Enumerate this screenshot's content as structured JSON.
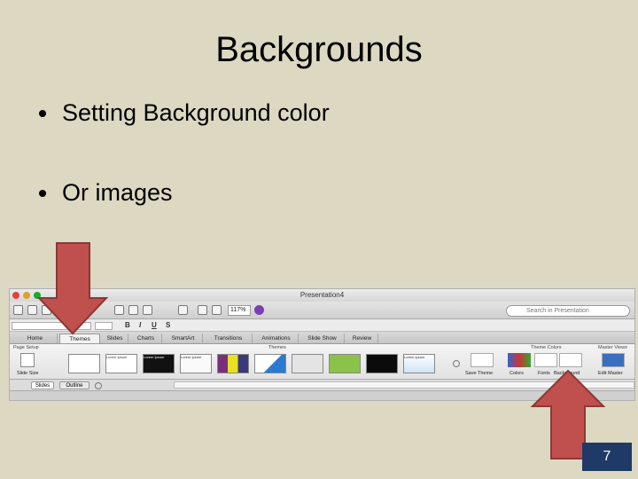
{
  "slide": {
    "title": "Backgrounds",
    "bullets": [
      "Setting Background color",
      "Or images"
    ],
    "page_number": "7"
  },
  "app": {
    "window_title": "Presentation4",
    "zoom": "117%",
    "search_placeholder": "Search in Presentation",
    "format_labels": [
      "B",
      "I",
      "U",
      "S"
    ],
    "tabs": [
      "Home",
      "Themes",
      "Slides",
      "Charts",
      "SmartArt",
      "Transitions",
      "Animations",
      "Slide Show",
      "Review"
    ],
    "active_tab": "Themes",
    "ribbon": {
      "page_setup_label": "Page Setup",
      "slide_size_label": "Slide Size",
      "themes_label": "Themes",
      "theme_colors_label": "Theme Colors",
      "master_views_label": "Master Views",
      "theme_thumb_text": "Lorem Ipsum",
      "save_theme": "Save Theme",
      "colors": "Colors",
      "fonts": "Fonts",
      "background": "Background",
      "edit_master": "Edit Master"
    },
    "pane_tabs": [
      "Slides",
      "Outline"
    ]
  },
  "colors": {
    "slide_bg": "#ddd8c2",
    "arrow": "#c0504d",
    "arrow_border": "#8c3836",
    "page_num_bg": "#1f3a66"
  }
}
